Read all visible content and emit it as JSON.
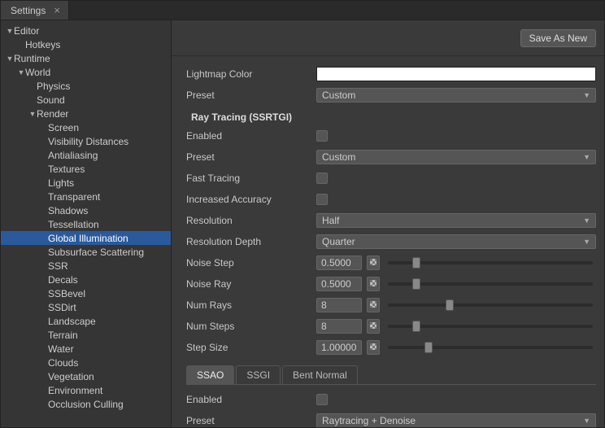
{
  "tab": {
    "title": "Settings"
  },
  "topbar": {
    "save_as_new": "Save As New"
  },
  "tree": [
    {
      "label": "Editor",
      "depth": 0,
      "arrow": "down"
    },
    {
      "label": "Hotkeys",
      "depth": 1
    },
    {
      "label": "Runtime",
      "depth": 0,
      "arrow": "down"
    },
    {
      "label": "World",
      "depth": 1,
      "arrow": "down"
    },
    {
      "label": "Physics",
      "depth": 2
    },
    {
      "label": "Sound",
      "depth": 2
    },
    {
      "label": "Render",
      "depth": 2,
      "arrow": "down"
    },
    {
      "label": "Screen",
      "depth": 3
    },
    {
      "label": "Visibility Distances",
      "depth": 3
    },
    {
      "label": "Antialiasing",
      "depth": 3
    },
    {
      "label": "Textures",
      "depth": 3
    },
    {
      "label": "Lights",
      "depth": 3
    },
    {
      "label": "Transparent",
      "depth": 3
    },
    {
      "label": "Shadows",
      "depth": 3
    },
    {
      "label": "Tessellation",
      "depth": 3
    },
    {
      "label": "Global Illumination",
      "depth": 3,
      "selected": true
    },
    {
      "label": "Subsurface Scattering",
      "depth": 3
    },
    {
      "label": "SSR",
      "depth": 3
    },
    {
      "label": "Decals",
      "depth": 3
    },
    {
      "label": "SSBevel",
      "depth": 3
    },
    {
      "label": "SSDirt",
      "depth": 3
    },
    {
      "label": "Landscape",
      "depth": 3
    },
    {
      "label": "Terrain",
      "depth": 3
    },
    {
      "label": "Water",
      "depth": 3
    },
    {
      "label": "Clouds",
      "depth": 3
    },
    {
      "label": "Vegetation",
      "depth": 3
    },
    {
      "label": "Environment",
      "depth": 3
    },
    {
      "label": "Occlusion Culling",
      "depth": 3
    }
  ],
  "form": {
    "lightmap_color_label": "Lightmap Color",
    "lightmap_color_value": "#ffffff",
    "preset1_label": "Preset",
    "preset1_value": "Custom",
    "section_rt": "Ray Tracing (SSRTGI)",
    "enabled_label": "Enabled",
    "preset2_label": "Preset",
    "preset2_value": "Custom",
    "fast_tracing_label": "Fast Tracing",
    "inc_accuracy_label": "Increased Accuracy",
    "resolution_label": "Resolution",
    "resolution_value": "Half",
    "resolution_depth_label": "Resolution Depth",
    "resolution_depth_value": "Quarter",
    "noise_step_label": "Noise Step",
    "noise_step_value": "0.5000",
    "noise_step_pct": 12,
    "noise_ray_label": "Noise Ray",
    "noise_ray_value": "0.5000",
    "noise_ray_pct": 12,
    "num_rays_label": "Num Rays",
    "num_rays_value": "8",
    "num_rays_pct": 28,
    "num_steps_label": "Num Steps",
    "num_steps_value": "8",
    "num_steps_pct": 12,
    "step_size_label": "Step Size",
    "step_size_value": "1.00000",
    "step_size_pct": 18,
    "subtabs": [
      "SSAO",
      "SSGI",
      "Bent Normal"
    ],
    "subtab_active": 0,
    "ssao_enabled_label": "Enabled",
    "ssao_preset_label": "Preset",
    "ssao_preset_value": "Raytracing + Denoise"
  }
}
